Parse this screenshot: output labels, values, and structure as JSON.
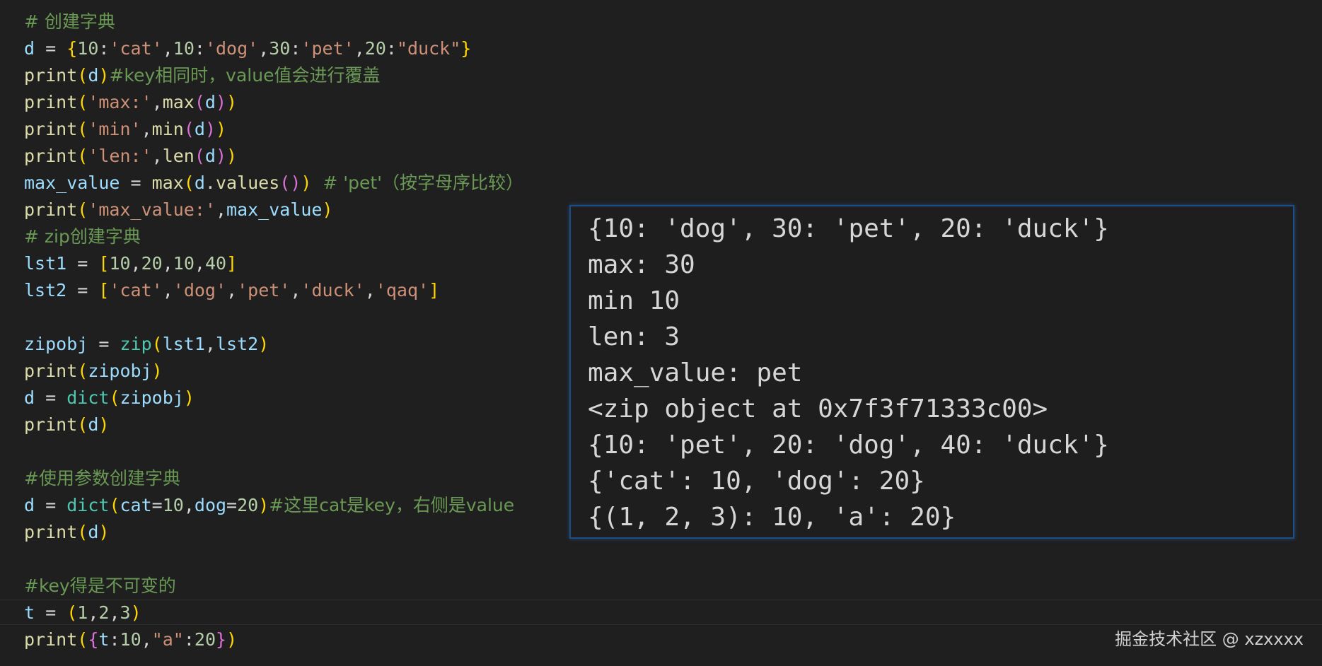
{
  "editor": {
    "lines": [
      [
        {
          "t": "# 创建字典",
          "c": "comment"
        }
      ],
      [
        {
          "t": "d",
          "c": "var"
        },
        {
          "t": " = ",
          "c": "plain"
        },
        {
          "t": "{",
          "c": "b1"
        },
        {
          "t": "10",
          "c": "num"
        },
        {
          "t": ":",
          "c": "plain"
        },
        {
          "t": "'cat'",
          "c": "str"
        },
        {
          "t": ",",
          "c": "plain"
        },
        {
          "t": "10",
          "c": "num"
        },
        {
          "t": ":",
          "c": "plain"
        },
        {
          "t": "'dog'",
          "c": "str"
        },
        {
          "t": ",",
          "c": "plain"
        },
        {
          "t": "30",
          "c": "num"
        },
        {
          "t": ":",
          "c": "plain"
        },
        {
          "t": "'pet'",
          "c": "str"
        },
        {
          "t": ",",
          "c": "plain"
        },
        {
          "t": "20",
          "c": "num"
        },
        {
          "t": ":",
          "c": "plain"
        },
        {
          "t": "\"duck\"",
          "c": "str"
        },
        {
          "t": "}",
          "c": "b1"
        }
      ],
      [
        {
          "t": "print",
          "c": "func"
        },
        {
          "t": "(",
          "c": "b1"
        },
        {
          "t": "d",
          "c": "var"
        },
        {
          "t": ")",
          "c": "b1"
        },
        {
          "t": "#key相同时，value值会进行覆盖",
          "c": "comment"
        }
      ],
      [
        {
          "t": "print",
          "c": "func"
        },
        {
          "t": "(",
          "c": "b1"
        },
        {
          "t": "'max:'",
          "c": "str"
        },
        {
          "t": ",",
          "c": "plain"
        },
        {
          "t": "max",
          "c": "func"
        },
        {
          "t": "(",
          "c": "b2"
        },
        {
          "t": "d",
          "c": "var"
        },
        {
          "t": ")",
          "c": "b2"
        },
        {
          "t": ")",
          "c": "b1"
        }
      ],
      [
        {
          "t": "print",
          "c": "func"
        },
        {
          "t": "(",
          "c": "b1"
        },
        {
          "t": "'min'",
          "c": "str"
        },
        {
          "t": ",",
          "c": "plain"
        },
        {
          "t": "min",
          "c": "func"
        },
        {
          "t": "(",
          "c": "b2"
        },
        {
          "t": "d",
          "c": "var"
        },
        {
          "t": ")",
          "c": "b2"
        },
        {
          "t": ")",
          "c": "b1"
        }
      ],
      [
        {
          "t": "print",
          "c": "func"
        },
        {
          "t": "(",
          "c": "b1"
        },
        {
          "t": "'len:'",
          "c": "str"
        },
        {
          "t": ",",
          "c": "plain"
        },
        {
          "t": "len",
          "c": "func"
        },
        {
          "t": "(",
          "c": "b2"
        },
        {
          "t": "d",
          "c": "var"
        },
        {
          "t": ")",
          "c": "b2"
        },
        {
          "t": ")",
          "c": "b1"
        }
      ],
      [
        {
          "t": "max_value",
          "c": "var"
        },
        {
          "t": " = ",
          "c": "plain"
        },
        {
          "t": "max",
          "c": "func"
        },
        {
          "t": "(",
          "c": "b1"
        },
        {
          "t": "d",
          "c": "var"
        },
        {
          "t": ".",
          "c": "plain"
        },
        {
          "t": "values",
          "c": "func"
        },
        {
          "t": "()",
          "c": "b2"
        },
        {
          "t": ")",
          "c": "b1"
        },
        {
          "t": "  # 'pet'（按字母序比较）",
          "c": "comment"
        }
      ],
      [
        {
          "t": "print",
          "c": "func"
        },
        {
          "t": "(",
          "c": "b1"
        },
        {
          "t": "'max_value:'",
          "c": "str"
        },
        {
          "t": ",",
          "c": "plain"
        },
        {
          "t": "max_value",
          "c": "var"
        },
        {
          "t": ")",
          "c": "b1"
        }
      ],
      [
        {
          "t": "# zip创建字典",
          "c": "comment"
        }
      ],
      [
        {
          "t": "lst1",
          "c": "var"
        },
        {
          "t": " = ",
          "c": "plain"
        },
        {
          "t": "[",
          "c": "b1"
        },
        {
          "t": "10",
          "c": "num"
        },
        {
          "t": ",",
          "c": "plain"
        },
        {
          "t": "20",
          "c": "num"
        },
        {
          "t": ",",
          "c": "plain"
        },
        {
          "t": "10",
          "c": "num"
        },
        {
          "t": ",",
          "c": "plain"
        },
        {
          "t": "40",
          "c": "num"
        },
        {
          "t": "]",
          "c": "b1"
        }
      ],
      [
        {
          "t": "lst2",
          "c": "var"
        },
        {
          "t": " = ",
          "c": "plain"
        },
        {
          "t": "[",
          "c": "b1"
        },
        {
          "t": "'cat'",
          "c": "str"
        },
        {
          "t": ",",
          "c": "plain"
        },
        {
          "t": "'dog'",
          "c": "str"
        },
        {
          "t": ",",
          "c": "plain"
        },
        {
          "t": "'pet'",
          "c": "str"
        },
        {
          "t": ",",
          "c": "plain"
        },
        {
          "t": "'duck'",
          "c": "str"
        },
        {
          "t": ",",
          "c": "plain"
        },
        {
          "t": "'qaq'",
          "c": "str"
        },
        {
          "t": "]",
          "c": "b1"
        }
      ],
      [],
      [
        {
          "t": "zipobj",
          "c": "var"
        },
        {
          "t": " = ",
          "c": "plain"
        },
        {
          "t": "zip",
          "c": "builtin"
        },
        {
          "t": "(",
          "c": "b1"
        },
        {
          "t": "lst1",
          "c": "var"
        },
        {
          "t": ",",
          "c": "plain"
        },
        {
          "t": "lst2",
          "c": "var"
        },
        {
          "t": ")",
          "c": "b1"
        }
      ],
      [
        {
          "t": "print",
          "c": "func"
        },
        {
          "t": "(",
          "c": "b1"
        },
        {
          "t": "zipobj",
          "c": "var"
        },
        {
          "t": ")",
          "c": "b1"
        }
      ],
      [
        {
          "t": "d",
          "c": "var"
        },
        {
          "t": " = ",
          "c": "plain"
        },
        {
          "t": "dict",
          "c": "builtin"
        },
        {
          "t": "(",
          "c": "b1"
        },
        {
          "t": "zipobj",
          "c": "var"
        },
        {
          "t": ")",
          "c": "b1"
        }
      ],
      [
        {
          "t": "print",
          "c": "func"
        },
        {
          "t": "(",
          "c": "b1"
        },
        {
          "t": "d",
          "c": "var"
        },
        {
          "t": ")",
          "c": "b1"
        }
      ],
      [],
      [
        {
          "t": "#使用参数创建字典",
          "c": "comment"
        }
      ],
      [
        {
          "t": "d",
          "c": "var"
        },
        {
          "t": " = ",
          "c": "plain"
        },
        {
          "t": "dict",
          "c": "builtin"
        },
        {
          "t": "(",
          "c": "b1"
        },
        {
          "t": "cat",
          "c": "var"
        },
        {
          "t": "=",
          "c": "plain"
        },
        {
          "t": "10",
          "c": "num"
        },
        {
          "t": ",",
          "c": "plain"
        },
        {
          "t": "dog",
          "c": "var"
        },
        {
          "t": "=",
          "c": "plain"
        },
        {
          "t": "20",
          "c": "num"
        },
        {
          "t": ")",
          "c": "b1"
        },
        {
          "t": "#这里cat是key，右侧是value",
          "c": "comment"
        }
      ],
      [
        {
          "t": "print",
          "c": "func"
        },
        {
          "t": "(",
          "c": "b1"
        },
        {
          "t": "d",
          "c": "var"
        },
        {
          "t": ")",
          "c": "b1"
        }
      ],
      [],
      [
        {
          "t": "#key得是不可变的",
          "c": "comment"
        }
      ],
      [
        {
          "t": "t",
          "c": "var"
        },
        {
          "t": " = ",
          "c": "plain"
        },
        {
          "t": "(",
          "c": "b1"
        },
        {
          "t": "1",
          "c": "num"
        },
        {
          "t": ",",
          "c": "plain"
        },
        {
          "t": "2",
          "c": "num"
        },
        {
          "t": ",",
          "c": "plain"
        },
        {
          "t": "3",
          "c": "num"
        },
        {
          "t": ")",
          "c": "b1"
        }
      ],
      [
        {
          "t": "print",
          "c": "func"
        },
        {
          "t": "(",
          "c": "b1"
        },
        {
          "t": "{",
          "c": "b2"
        },
        {
          "t": "t",
          "c": "var"
        },
        {
          "t": ":",
          "c": "plain"
        },
        {
          "t": "10",
          "c": "num"
        },
        {
          "t": ",",
          "c": "plain"
        },
        {
          "t": "\"a\"",
          "c": "str"
        },
        {
          "t": ":",
          "c": "plain"
        },
        {
          "t": "20",
          "c": "num"
        },
        {
          "t": "}",
          "c": "b2"
        },
        {
          "t": ")",
          "c": "b1"
        }
      ]
    ]
  },
  "output": {
    "lines": [
      "{10: 'dog', 30: 'pet', 20: 'duck'}",
      "max: 30",
      "min 10",
      "len: 3",
      "max_value: pet",
      "<zip object at 0x7f3f71333c00>",
      "{10: 'pet', 20: 'dog', 40: 'duck'}",
      "{'cat': 10, 'dog': 20}",
      "{(1, 2, 3): 10, 'a': 20}"
    ]
  },
  "watermark": "掘金技术社区 @ xzxxxx",
  "colors": {
    "background": "#1f1f1f",
    "comment": "#6a9955",
    "variable": "#9cdcfe",
    "function": "#dcdcaa",
    "builtin": "#4ec9b0",
    "number": "#b5cea8",
    "string": "#ce9178",
    "bracket_level1": "#ffd700",
    "bracket_level2": "#da70d6",
    "panel_border": "#1b4f8a"
  }
}
